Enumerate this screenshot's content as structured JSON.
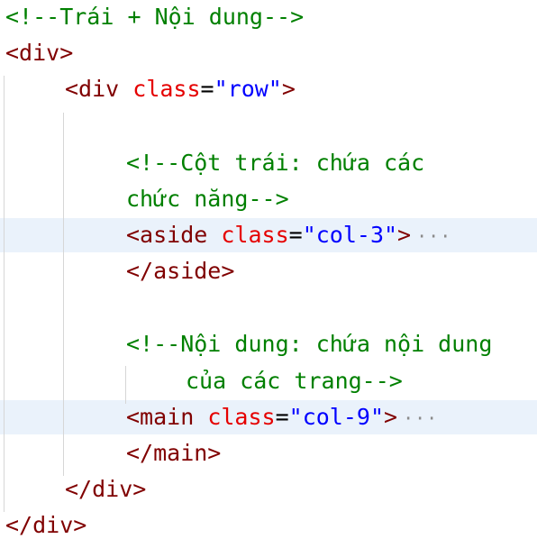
{
  "editor": {
    "colors": {
      "background": "#ffffff",
      "highlight": "#eaf2fb",
      "comment": "#008000",
      "tag": "#800000",
      "attribute": "#e50000",
      "string": "#0000ff",
      "indent_guide": "#d6d6d6"
    },
    "lines": [
      {
        "tokens": [
          {
            "t": "comment",
            "v": "<!--Trái + Nội dung-->"
          }
        ]
      },
      {
        "tokens": [
          {
            "t": "tag",
            "v": "<div>"
          }
        ]
      },
      {
        "tokens": [
          {
            "t": "tag",
            "v": "<div "
          },
          {
            "t": "attr",
            "v": "class"
          },
          {
            "t": "eq",
            "v": "="
          },
          {
            "t": "str",
            "v": "\"row\""
          },
          {
            "t": "tag",
            "v": ">"
          }
        ]
      },
      {
        "tokens": []
      },
      {
        "tokens": [
          {
            "t": "comment",
            "v": "<!--Cột trái: chứa các"
          }
        ]
      },
      {
        "tokens": [
          {
            "t": "comment",
            "v": "chức năng-->"
          }
        ]
      },
      {
        "tokens": [
          {
            "t": "tag",
            "v": "<aside "
          },
          {
            "t": "attr",
            "v": "class"
          },
          {
            "t": "eq",
            "v": "="
          },
          {
            "t": "str",
            "v": "\"col-3\""
          },
          {
            "t": "tag",
            "v": ">"
          }
        ],
        "fold": "···"
      },
      {
        "tokens": [
          {
            "t": "tag",
            "v": "</aside>"
          }
        ]
      },
      {
        "tokens": []
      },
      {
        "tokens": [
          {
            "t": "comment",
            "v": "<!--Nội dung: chứa nội dung"
          }
        ]
      },
      {
        "tokens": [
          {
            "t": "comment",
            "v": "của các trang-->"
          }
        ]
      },
      {
        "tokens": [
          {
            "t": "tag",
            "v": "<main "
          },
          {
            "t": "attr",
            "v": "class"
          },
          {
            "t": "eq",
            "v": "="
          },
          {
            "t": "str",
            "v": "\"col-9\""
          },
          {
            "t": "tag",
            "v": ">"
          }
        ],
        "fold": "···"
      },
      {
        "tokens": [
          {
            "t": "tag",
            "v": "</main>"
          }
        ]
      },
      {
        "tokens": [
          {
            "t": "tag",
            "v": "</div>"
          }
        ]
      },
      {
        "tokens": [
          {
            "t": "tag",
            "v": "</div>"
          }
        ]
      }
    ]
  }
}
